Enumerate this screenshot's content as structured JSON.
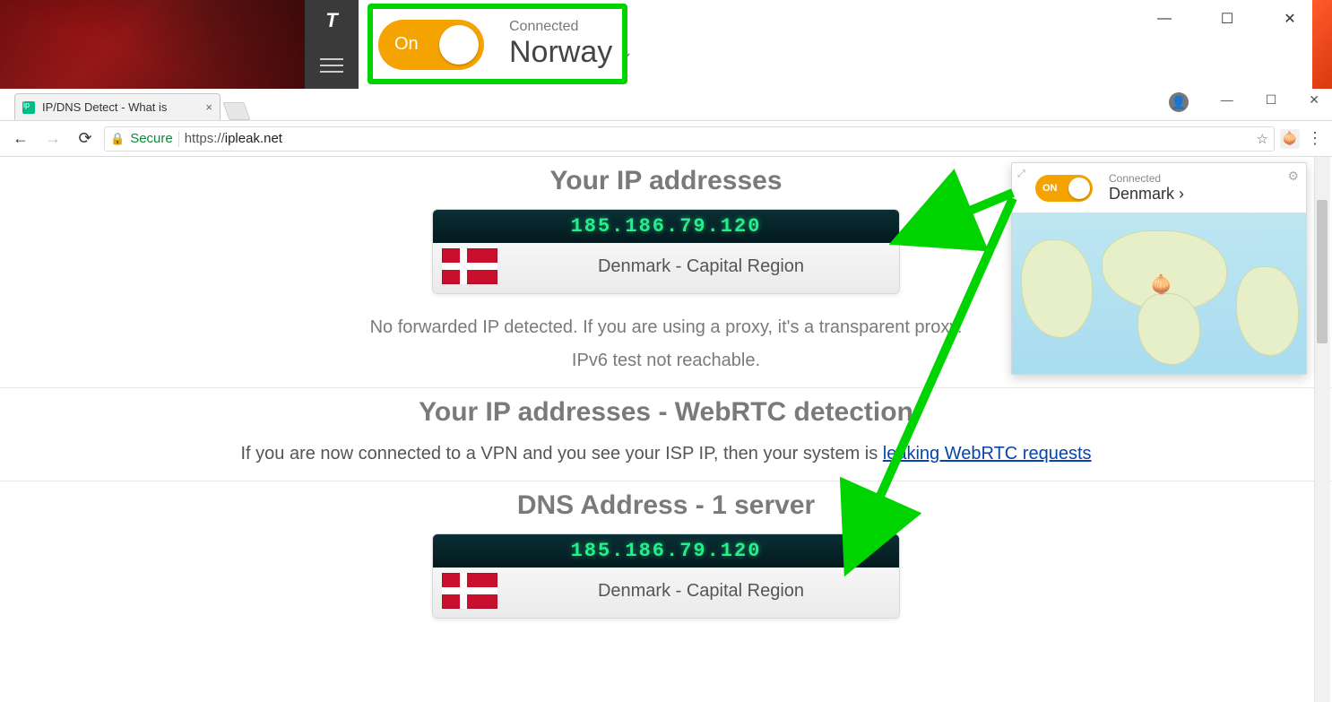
{
  "vpn_app": {
    "toggle_label": "On",
    "status": "Connected",
    "country": "Norway"
  },
  "browser": {
    "tab_title": "IP/DNS Detect - What is",
    "secure_label": "Secure",
    "url_proto": "https://",
    "url_host": "ipleak.net"
  },
  "page": {
    "heading_ip": "Your IP addresses",
    "ip_value": "185.186.79.120",
    "ip_location": "Denmark - Capital Region",
    "no_forward": "No forwarded IP detected. If you are using a proxy, it's a transparent proxy.",
    "ipv6": "IPv6 test not reachable.",
    "heading_webrtc": "Your IP addresses - WebRTC detection",
    "webrtc_line_pre": "If you are now connected to a VPN and you see your ISP IP, then your system is ",
    "webrtc_link": "leaking WebRTC requests",
    "heading_dns": "DNS Address - 1 server",
    "dns_value": "185.186.79.120",
    "dns_location": "Denmark - Capital Region"
  },
  "extension": {
    "toggle_label": "ON",
    "status": "Connected",
    "country": "Denmark"
  }
}
